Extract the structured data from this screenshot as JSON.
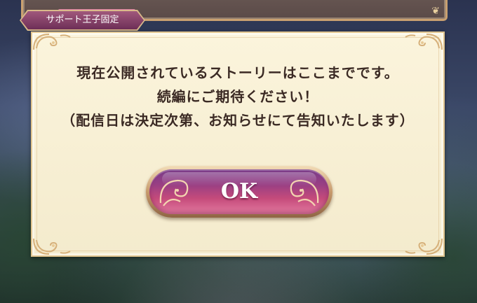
{
  "support_tag": {
    "label": "サポート王子固定"
  },
  "dialog": {
    "message_lines": [
      "現在公開されているストーリーはここまでです。",
      "続編にご期待ください！",
      "（配信日は決定次第、お知らせにて告知いたします）"
    ],
    "ok_label": "OK"
  },
  "colors": {
    "dialog_bg": "#f7efd4",
    "dialog_border": "#e1c58f",
    "text": "#3b2a24",
    "button_top": "#7a3c8a",
    "button_bottom": "#e37aa0",
    "tag_bg": "#8c4470"
  },
  "icons": {
    "corner_ornament": "scroll-ornament-icon",
    "button_ornament": "swirl-ornament-icon"
  }
}
